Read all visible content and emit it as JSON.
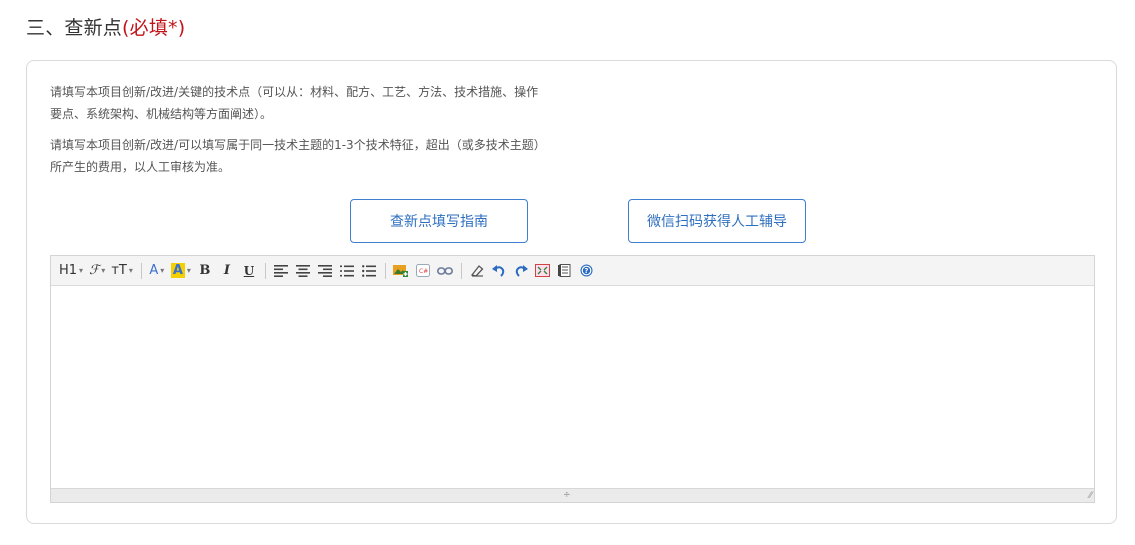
{
  "section": {
    "title": "三、查新点",
    "required": "(必填*)"
  },
  "hints": {
    "line1": "请填写本项目创新/改进/关键的技术点（可以从：材料、配方、工艺、方法、技术措施、操作要点、系统架构、机械结构等方面阐述）。",
    "line2": "请填写本项目创新/改进/可以填写属于同一技术主题的1-3个技术特征，超出（或多技术主题）所产生的费用，以人工审核为准。"
  },
  "buttons": {
    "guide": "查新点填写指南",
    "wechat": "微信扫码获得人工辅导"
  },
  "toolbar": {
    "heading": "H1",
    "font_family": "ℱ",
    "font_size": "ᴛT",
    "font_color": "A",
    "bg_color": "A",
    "bold": "B",
    "italic": "I",
    "underline": "U"
  },
  "colors": {
    "required": "#c0141a",
    "button_border": "#3f7fd0",
    "highlight": "#f5d000"
  }
}
